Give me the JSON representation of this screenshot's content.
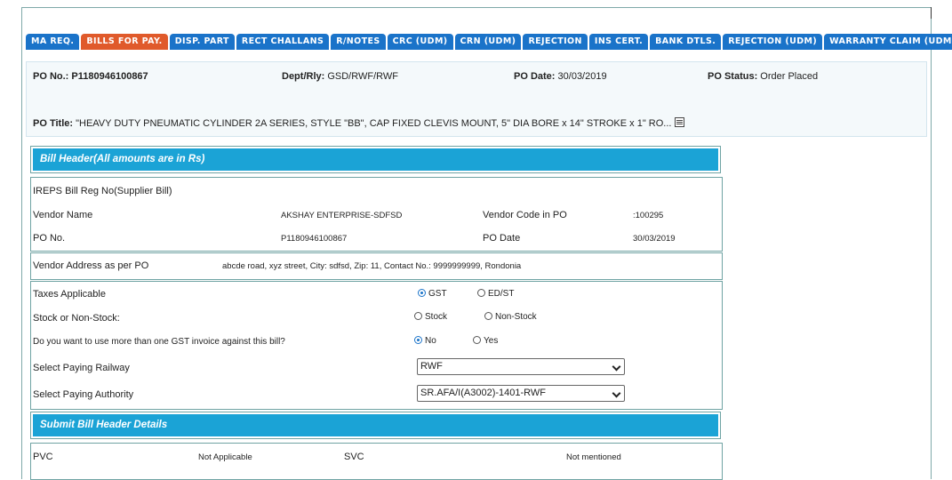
{
  "tabs": [
    {
      "label": "MA REQ.",
      "active": false
    },
    {
      "label": "BILLS FOR PAY.",
      "active": true
    },
    {
      "label": "DISP. PART",
      "active": false
    },
    {
      "label": "RECT CHALLANS",
      "active": false
    },
    {
      "label": "R/NOTES",
      "active": false
    },
    {
      "label": "CRC (UDM)",
      "active": false
    },
    {
      "label": "CRN (UDM)",
      "active": false
    },
    {
      "label": "REJECTION",
      "active": false
    },
    {
      "label": "INS CERT.",
      "active": false
    },
    {
      "label": "BANK DTLS.",
      "active": false
    },
    {
      "label": "REJECTION (UDM)",
      "active": false
    },
    {
      "label": "WARRANTY CLAIM (UDM)",
      "active": false
    }
  ],
  "po": {
    "no_label": "PO No.:",
    "no_value": "P1180946100867",
    "dept_label": "Dept/Rly:",
    "dept_value": "GSD/RWF/RWF",
    "date_label": "PO Date:",
    "date_value": "30/03/2019",
    "status_label": "PO Status:",
    "status_value": "Order Placed",
    "title_label": "PO Title:",
    "title_value": "\"HEAVY DUTY PNEUMATIC CYLINDER 2A SERIES, STYLE \"BB\", CAP FIXED CLEVIS MOUNT, 5\" DIA BORE x 14\" STROKE x 1\" RO..."
  },
  "bill_header": {
    "title": "Bill Header(All amounts are in Rs)",
    "ireps_label": "IREPS Bill Reg No(Supplier Bill)",
    "vendor_name_label": "Vendor Name",
    "vendor_name_value": "AKSHAY ENTERPRISE-SDFSD",
    "vendor_code_label": "Vendor Code in PO",
    "vendor_code_value": ":100295",
    "po_no_label": "PO No.",
    "po_no_value": "P1180946100867",
    "po_date_label": "PO Date",
    "po_date_value": "30/03/2019"
  },
  "address": {
    "label": "Vendor Address as per PO",
    "value": "abcde road, xyz street, City: sdfsd, Zip: 11, Contact No.: 9999999999, Rondonia"
  },
  "form": {
    "taxes_label": "Taxes Applicable",
    "taxes_opt1": "GST",
    "taxes_opt2": "ED/ST",
    "stock_label": "Stock or Non-Stock:",
    "stock_opt1": "Stock",
    "stock_opt2": "Non-Stock",
    "gst_label": "Do you want to use more than one GST invoice against this bill?",
    "gst_opt1": "No",
    "gst_opt2": "Yes",
    "railway_label": "Select Paying Railway",
    "railway_value": "RWF",
    "authority_label": "Select Paying Authority",
    "authority_value": "SR.AFA/I(A3002)-1401-RWF"
  },
  "submit": {
    "title": "Submit Bill Header Details",
    "pvc_label": "PVC",
    "pvc_value": "Not Applicable",
    "svc_label": "SVC",
    "svc_value": "Not mentioned"
  },
  "colors": {
    "tab": "#1a73c9",
    "tab_active": "#e05a2b",
    "section_bar": "#1ba3d6"
  }
}
